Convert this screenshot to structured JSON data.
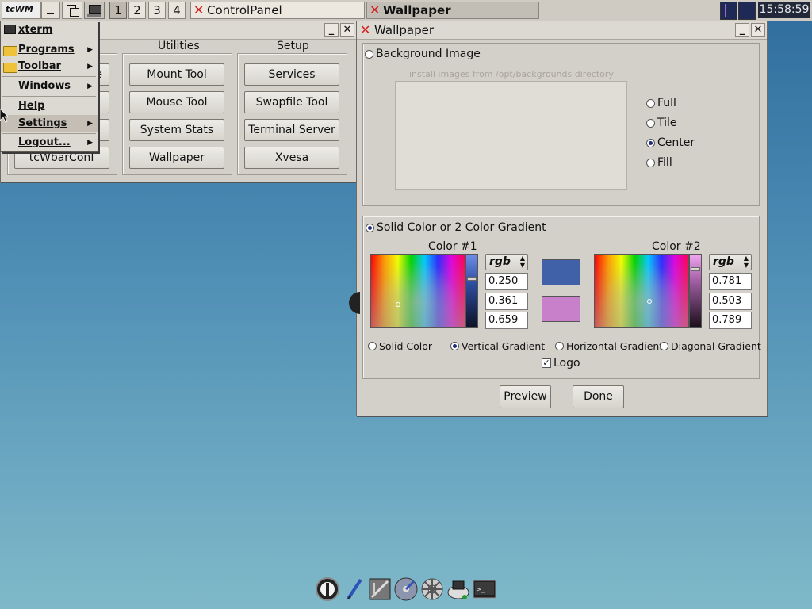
{
  "taskbar": {
    "app_logo": "tcWM",
    "desktops": [
      "1",
      "2",
      "3",
      "4"
    ],
    "tasks": [
      {
        "label": "ControlPanel",
        "active": false
      },
      {
        "label": "Wallpaper",
        "active": true
      }
    ],
    "clock": "15:58:59"
  },
  "menu": {
    "items": [
      {
        "label": "xterm",
        "icon": "terminal-icon",
        "submenu": false
      },
      {
        "label": "Programs",
        "icon": "folder-icon",
        "submenu": true
      },
      {
        "label": "Toolbar",
        "icon": "folder-icon",
        "submenu": true
      },
      {
        "label": "Windows",
        "icon": "",
        "submenu": true
      },
      {
        "label": "Help",
        "icon": "",
        "submenu": false
      },
      {
        "label": "Settings",
        "icon": "",
        "submenu": true,
        "highlighted": true
      },
      {
        "label": "Logout...",
        "icon": "",
        "submenu": true
      }
    ]
  },
  "control_panel": {
    "columns": [
      {
        "heading": "",
        "buttons": [
          "",
          "",
          "",
          "tcWbarConf"
        ],
        "partial": [
          "e",
          "",
          "",
          ""
        ]
      },
      {
        "heading": "Utilities",
        "buttons": [
          "Mount Tool",
          "Mouse Tool",
          "System Stats",
          "Wallpaper"
        ]
      },
      {
        "heading": "Setup",
        "buttons": [
          "Services",
          "Swapfile Tool",
          "Terminal Server",
          "Xvesa"
        ]
      }
    ]
  },
  "wallpaper": {
    "title": "Wallpaper",
    "background_image_label": "Background Image",
    "install_hint": "install images from /opt/backgrounds directory",
    "image_modes": [
      {
        "label": "Full",
        "selected": false
      },
      {
        "label": "Tile",
        "selected": false
      },
      {
        "label": "Center",
        "selected": true
      },
      {
        "label": "Fill",
        "selected": false
      }
    ],
    "solid_label": "Solid Color or 2 Color Gradient",
    "color1": {
      "heading": "Color #1",
      "mode": "rgb",
      "r": "0.250",
      "g": "0.361",
      "b": "0.659",
      "swatch": "#4060a8"
    },
    "color2": {
      "heading": "Color #2",
      "mode": "rgb",
      "r": "0.781",
      "g": "0.503",
      "b": "0.789",
      "swatch": "#c780c9"
    },
    "gradient_modes": [
      {
        "label": "Solid Color",
        "selected": false
      },
      {
        "label": "Vertical Gradient",
        "selected": true
      },
      {
        "label": "Horizontal Gradient",
        "selected": false
      },
      {
        "label": "Diagonal Gradient",
        "selected": false
      }
    ],
    "logo_label": "Logo",
    "logo_checked": true,
    "preview_label": "Preview",
    "done_label": "Done"
  },
  "dock": {
    "icons": [
      "power-icon",
      "paintbrush-icon",
      "control-panel-icon",
      "mount-icon",
      "settings-icon",
      "apps-icon",
      "terminal-icon"
    ]
  }
}
